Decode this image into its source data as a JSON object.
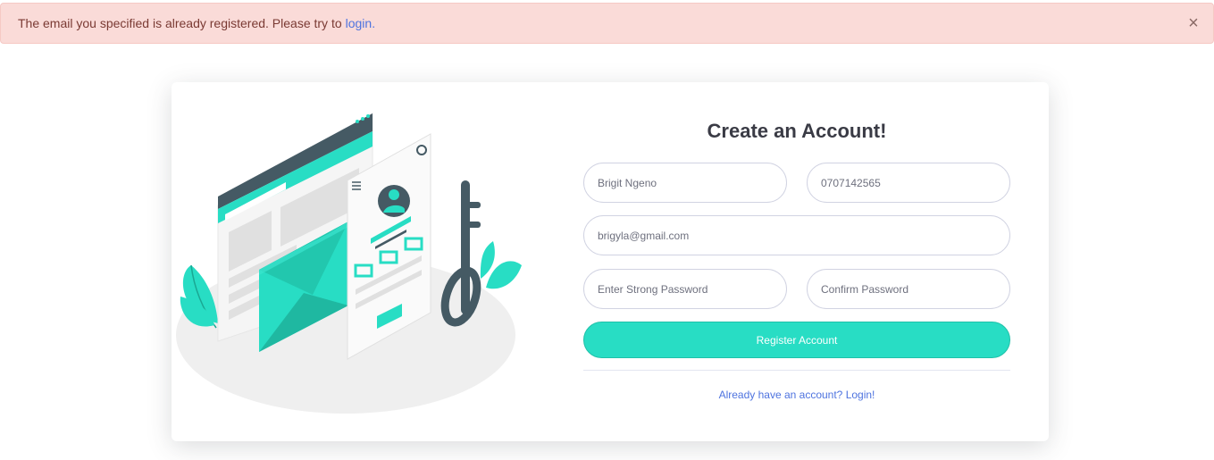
{
  "alert": {
    "message": "The email you specified is already registered. Please try to",
    "link_text": "login.",
    "close_symbol": "×"
  },
  "form": {
    "title": "Create an Account!",
    "name_value": "Brigit Ngeno",
    "phone_value": "0707142565",
    "email_value": "brigyla@gmail.com",
    "password_placeholder": "Enter Strong Password",
    "confirm_placeholder": "Confirm Password",
    "register_label": "Register Account",
    "login_link": "Already have an account? Login!"
  },
  "colors": {
    "accent": "#28ddc4",
    "link": "#4e73df",
    "alert_bg": "#fadbd8",
    "dark": "#455a64"
  }
}
